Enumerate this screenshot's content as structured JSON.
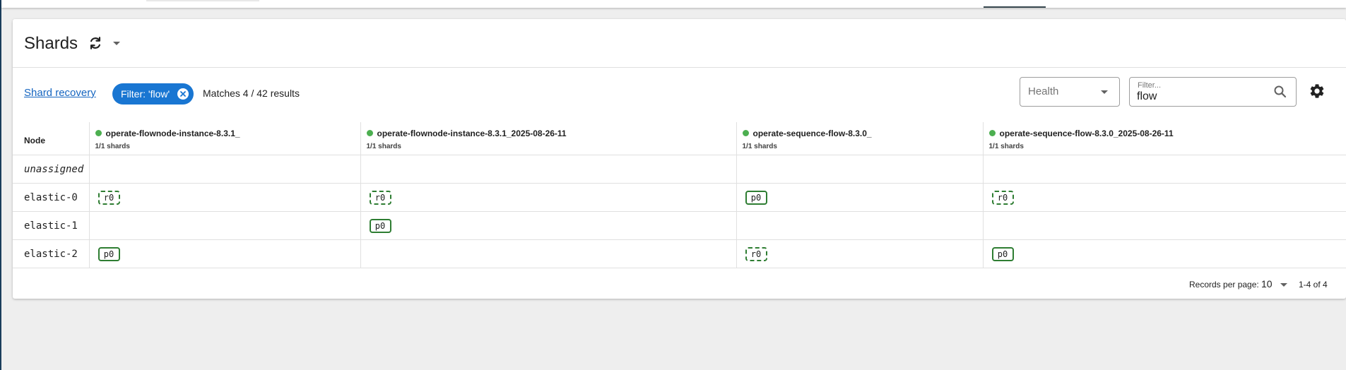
{
  "page": {
    "title": "Shards"
  },
  "icons": {
    "refresh": "refresh-icon",
    "dropdown": "chevron-down-icon",
    "chip_close": "close-circle-icon",
    "search": "search-icon",
    "settings": "gear-icon"
  },
  "toolbar": {
    "shard_recovery_link": "Shard recovery",
    "filter_chip_label": "Filter: 'flow'",
    "match_text": "Matches 4 / 42 results",
    "health_select": {
      "selected": "Health"
    },
    "filter_input": {
      "label": "Filter...",
      "value": "flow"
    }
  },
  "table": {
    "node_header": "Node",
    "indices": [
      {
        "name": "operate-flownode-instance-8.3.1_",
        "shards": "1/1 shards",
        "health": "green"
      },
      {
        "name": "operate-flownode-instance-8.3.1_2025-08-26-11",
        "shards": "1/1 shards",
        "health": "green"
      },
      {
        "name": "operate-sequence-flow-8.3.0_",
        "shards": "1/1 shards",
        "health": "green"
      },
      {
        "name": "operate-sequence-flow-8.3.0_2025-08-26-11",
        "shards": "1/1 shards",
        "health": "green"
      }
    ],
    "rows": [
      {
        "node": "unassigned",
        "cells": [
          "",
          "",
          "",
          ""
        ]
      },
      {
        "node": "elastic-0",
        "cells": [
          "r0",
          "r0",
          "p0",
          "r0"
        ]
      },
      {
        "node": "elastic-1",
        "cells": [
          "",
          "p0",
          "",
          ""
        ]
      },
      {
        "node": "elastic-2",
        "cells": [
          "p0",
          "",
          "r0",
          "p0"
        ]
      }
    ]
  },
  "pagination": {
    "records_per_page_label": "Records per page:",
    "records_per_page": "10",
    "range": "1-4 of 4"
  },
  "colors": {
    "accent": "#1976d2",
    "healthy": "#4caf50",
    "shard_border": "#2e7d32",
    "link": "#1565c0"
  }
}
